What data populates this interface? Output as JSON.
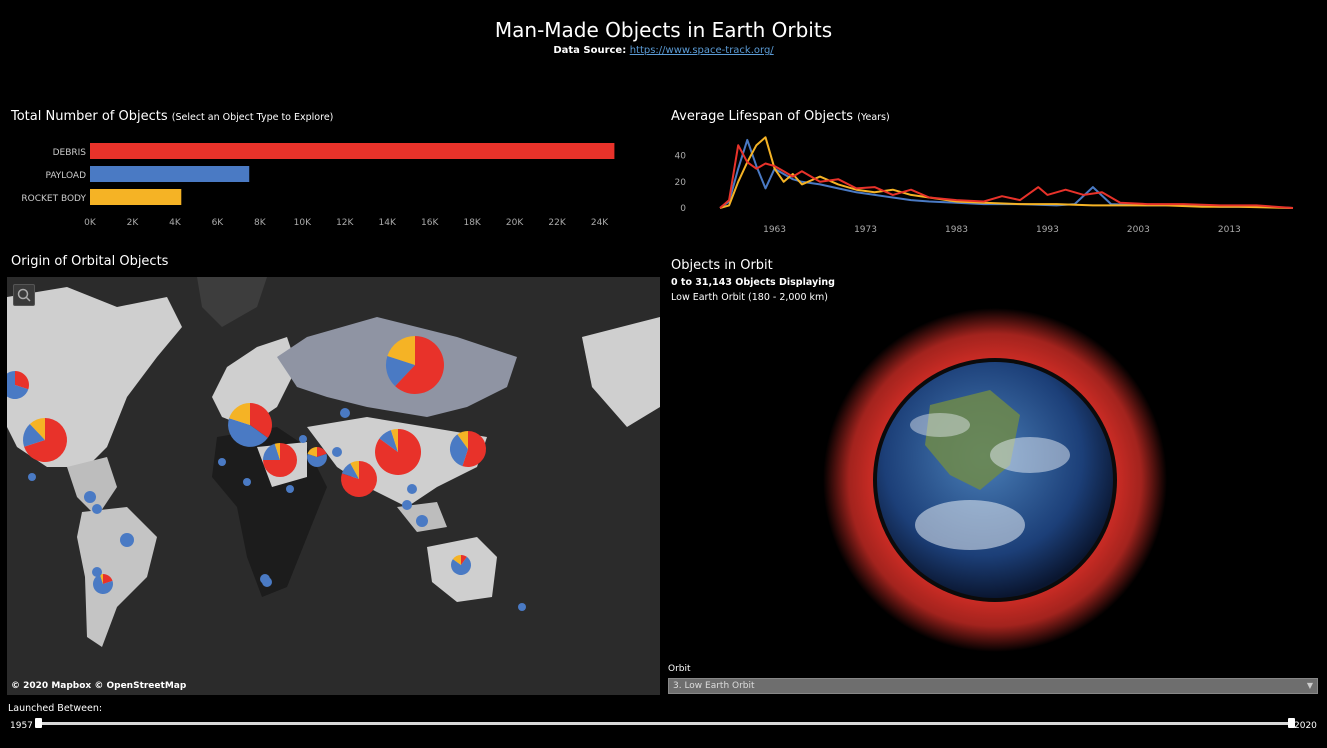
{
  "header": {
    "title": "Man-Made Objects in Earth Orbits",
    "source_label": "Data Source:",
    "source_link": "https://www.space-track.org/"
  },
  "bar_panel": {
    "title": "Total Number of Objects",
    "subtitle": "(Select an Object Type to Explore)"
  },
  "life_panel": {
    "title": "Average Lifespan of Objects",
    "subtitle": "(Years)"
  },
  "map_panel": {
    "title": "Origin of Orbital Objects",
    "credit": "© 2020 Mapbox © OpenStreetMap"
  },
  "orbit_panel": {
    "title": "Objects in Orbit",
    "count_text": "0 to 31,143 Objects Displaying",
    "orbit_range": "Low Earth Orbit (180 - 2,000 km)"
  },
  "filters": {
    "orbit_label": "Orbit",
    "orbit_value": "3. Low Earth Orbit",
    "launched_label": "Launched Between:",
    "year_start": "1957",
    "year_end": "2020"
  },
  "colors": {
    "debris": "#e8322a",
    "payload": "#4a7ac4",
    "rocket_body": "#f5b325",
    "background": "#000000"
  },
  "icons": {
    "search": "search-icon",
    "dropdown": "chevron-down-icon"
  },
  "chart_data": [
    {
      "type": "bar",
      "orientation": "horizontal",
      "categories": [
        "DEBRIS",
        "PAYLOAD",
        "ROCKET BODY"
      ],
      "values": [
        24700,
        7500,
        4300
      ],
      "colors": [
        "#e8322a",
        "#4a7ac4",
        "#f5b325"
      ],
      "xticks": [
        "0K",
        "2K",
        "4K",
        "6K",
        "8K",
        "10K",
        "12K",
        "14K",
        "16K",
        "18K",
        "20K",
        "22K",
        "24K"
      ],
      "xlim": [
        0,
        26000
      ]
    },
    {
      "type": "line",
      "xlim": [
        1957,
        2020
      ],
      "ylim": [
        0,
        55
      ],
      "xticks": [
        "1963",
        "1973",
        "1983",
        "1993",
        "2003",
        "2013"
      ],
      "yticks": [
        "0",
        "20",
        "40"
      ],
      "series": [
        {
          "color": "#4a7ac4",
          "x": [
            1957,
            1958,
            1959,
            1960,
            1961,
            1962,
            1963,
            1964,
            1965,
            1966,
            1968,
            1970,
            1972,
            1974,
            1976,
            1978,
            1980,
            1983,
            1986,
            1990,
            1994,
            1996,
            1998,
            2000,
            2004,
            2008,
            2012,
            2016,
            2020
          ],
          "y": [
            0,
            5,
            30,
            52,
            32,
            15,
            30,
            26,
            22,
            20,
            18,
            15,
            12,
            10,
            8,
            6,
            5,
            4,
            3,
            3,
            2,
            3,
            16,
            3,
            2,
            2,
            1,
            1,
            0
          ]
        },
        {
          "color": "#f5b325",
          "x": [
            1957,
            1958,
            1959,
            1960,
            1961,
            1962,
            1963,
            1964,
            1965,
            1966,
            1968,
            1970,
            1972,
            1974,
            1976,
            1978,
            1980,
            1983,
            1986,
            1990,
            1994,
            1998,
            2002,
            2006,
            2010,
            2014,
            2020
          ],
          "y": [
            0,
            2,
            20,
            35,
            48,
            54,
            30,
            20,
            26,
            18,
            24,
            18,
            14,
            12,
            14,
            10,
            8,
            5,
            4,
            3,
            3,
            2,
            2,
            2,
            1,
            1,
            0
          ]
        },
        {
          "color": "#e8322a",
          "x": [
            1957,
            1958,
            1959,
            1960,
            1961,
            1962,
            1963,
            1964,
            1965,
            1966,
            1968,
            1970,
            1972,
            1974,
            1976,
            1978,
            1980,
            1983,
            1986,
            1988,
            1990,
            1992,
            1993,
            1995,
            1997,
            1999,
            2001,
            2004,
            2008,
            2012,
            2016,
            2020
          ],
          "y": [
            0,
            6,
            48,
            35,
            30,
            34,
            32,
            28,
            24,
            28,
            20,
            22,
            15,
            16,
            10,
            14,
            8,
            6,
            5,
            9,
            6,
            16,
            10,
            14,
            10,
            12,
            4,
            3,
            3,
            2,
            2,
            0
          ]
        }
      ]
    }
  ]
}
